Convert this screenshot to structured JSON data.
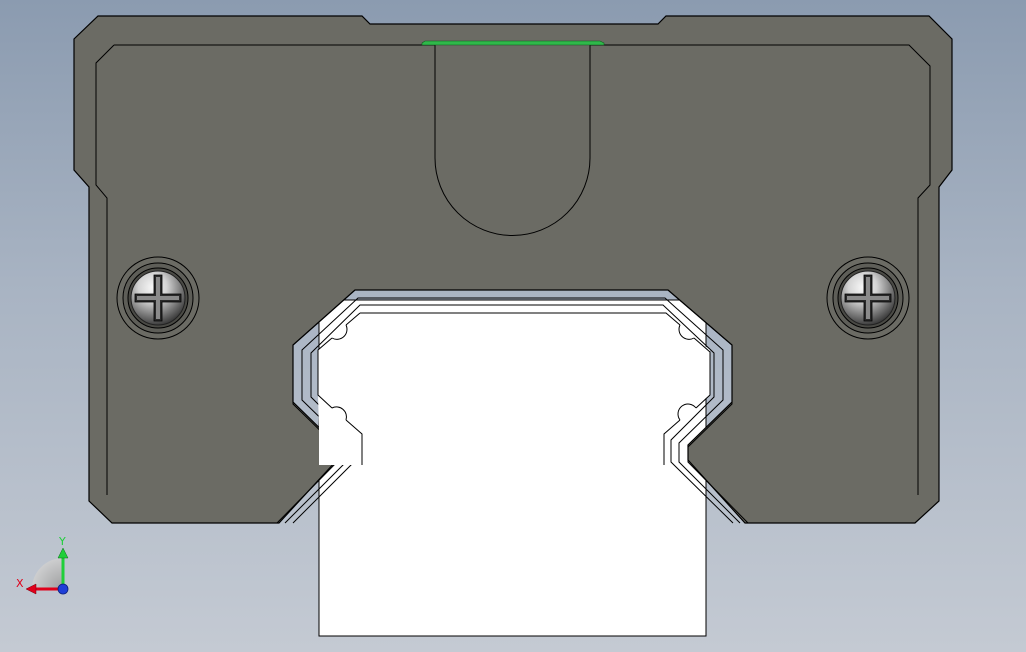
{
  "colors": {
    "background_top": "#8b9bb0",
    "background_bottom": "#c4cad3",
    "block_body": "#6b6b64",
    "block_edge": "#000000",
    "rail": "#ffffff",
    "seal_strip": "#2fb84a",
    "screw_highlight": "#f2f2f2",
    "screw_shadow": "#3a3a3a",
    "axis_x": "#e0001a",
    "axis_y": "#1fcf3a",
    "axis_z": "#1f3fd8"
  },
  "icons": {
    "left_screw": "phillips-screw-icon",
    "right_screw": "phillips-screw-icon",
    "triad": "coordinate-triad-icon"
  },
  "triad": {
    "x_label": "X",
    "y_label": "Y"
  }
}
